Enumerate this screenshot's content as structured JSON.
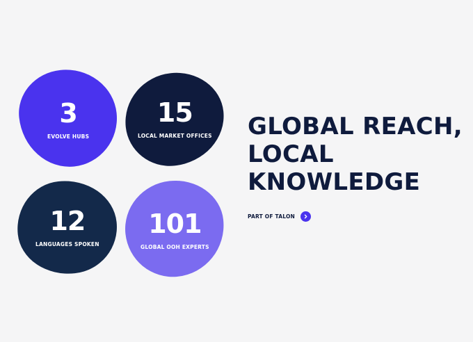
{
  "stats": [
    {
      "value": "3",
      "label": "EVOLVE HUBS",
      "color": "#4a33ee"
    },
    {
      "value": "15",
      "label": "LOCAL MARKET OFFICES",
      "color": "#0f1b3d"
    },
    {
      "value": "12",
      "label": "LANGUAGES SPOKEN",
      "color": "#13294a"
    },
    {
      "value": "101",
      "label": "GLOBAL OOH EXPERTS",
      "color": "#7b6bf0"
    }
  ],
  "headline": {
    "line1": "GLOBAL REACH,",
    "line2": "LOCAL",
    "line3": "KNOWLEDGE"
  },
  "cta": {
    "label": "PART OF TALON",
    "icon": "chevron-right-icon"
  },
  "colors": {
    "background": "#f5f5f6",
    "accent": "#4a33ee",
    "navy": "#0f1b3d"
  }
}
